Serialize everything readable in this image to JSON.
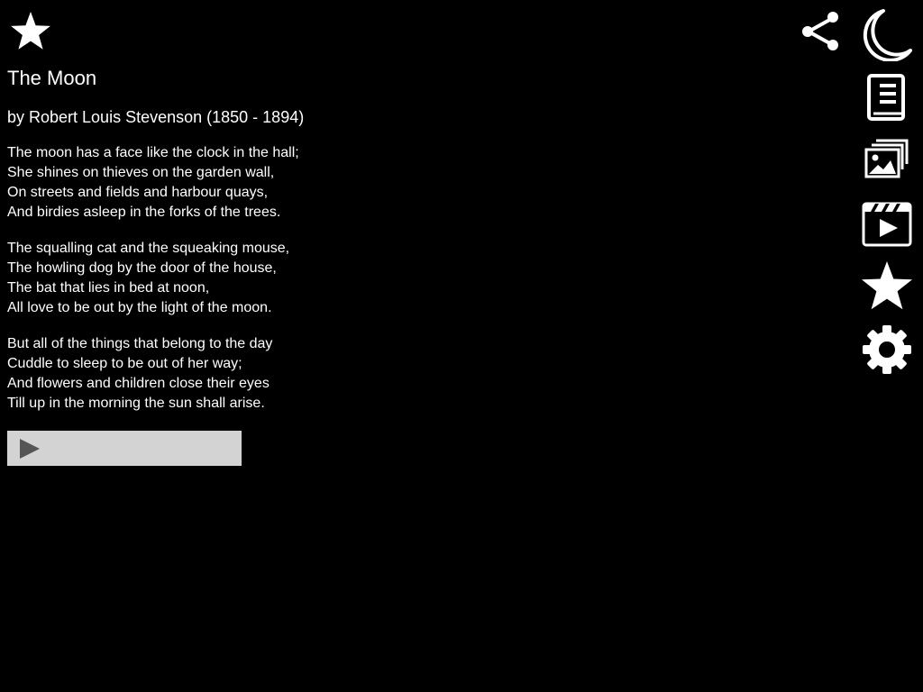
{
  "poem": {
    "title": "The Moon",
    "author": "by Robert Louis Stevenson (1850 - 1894)",
    "stanzas": [
      {
        "lines": [
          "The moon has a face like the clock in the hall;",
          "She shines on thieves on the garden wall,",
          "On streets and fields and harbour quays,",
          "And birdies asleep in the forks of the trees."
        ]
      },
      {
        "lines": [
          "The squalling cat and the squeaking mouse,",
          "The howling dog by the door of the house,",
          "The bat that lies in bed at noon,",
          "All love to be out by the light of the moon."
        ]
      },
      {
        "lines": [
          "But all of the things that belong to the day",
          "Cuddle to sleep to be out of her way;",
          "And flowers and children close their eyes",
          "Till up in the morning the sun shall arise."
        ]
      }
    ]
  },
  "toolbar": {
    "favorite_icon": "star-icon",
    "share_icon": "share-icon"
  },
  "sidebar": {
    "items": [
      {
        "icon": "moon-icon"
      },
      {
        "icon": "book-icon"
      },
      {
        "icon": "gallery-icon"
      },
      {
        "icon": "video-icon"
      },
      {
        "icon": "star-icon"
      },
      {
        "icon": "gear-icon"
      }
    ]
  },
  "player": {
    "play_icon": "play-icon"
  },
  "colors": {
    "background": "#000000",
    "text": "#ffffff",
    "player_bar": "#d3d3d3",
    "play_icon": "#555555"
  }
}
